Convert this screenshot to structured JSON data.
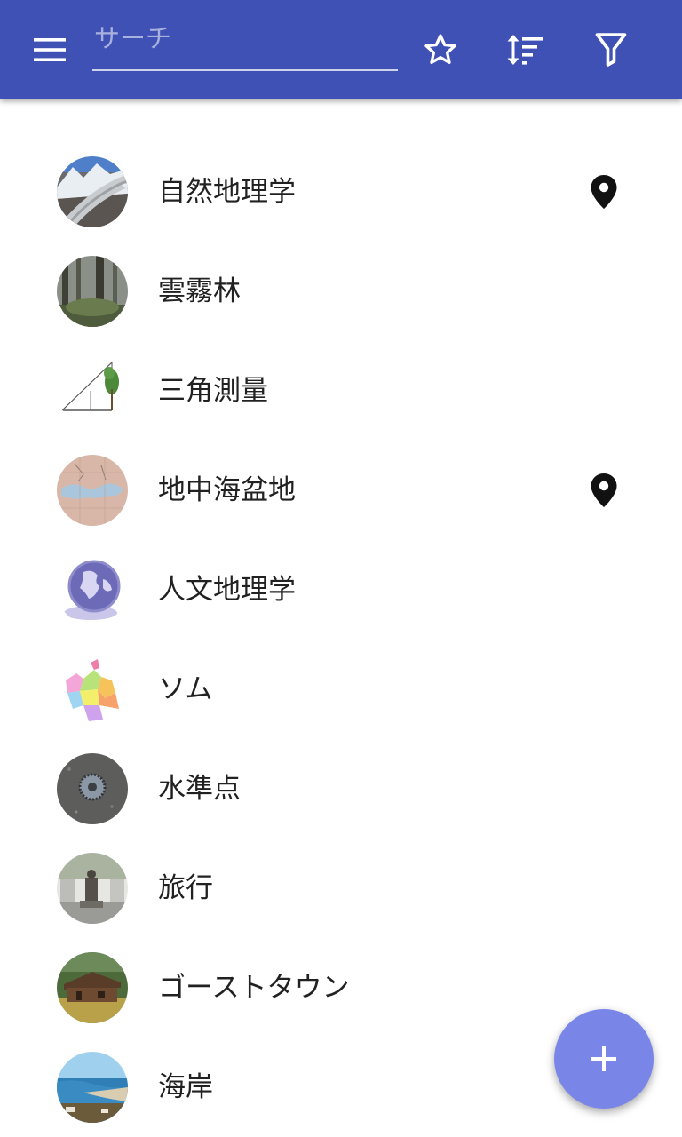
{
  "appbar": {
    "background": "#3f51b5",
    "menu_icon": "hamburger-menu-icon",
    "search": {
      "placeholder": "サーチ",
      "value": ""
    },
    "actions": [
      "star-outline-icon",
      "sort-icon",
      "filter-icon"
    ]
  },
  "list": {
    "items": [
      {
        "label": "自然地理学",
        "thumbnail": "glacier-mountain-photo",
        "has_location": true
      },
      {
        "label": "雲霧林",
        "thumbnail": "misty-forest-photo",
        "has_location": false
      },
      {
        "label": "三角測量",
        "thumbnail": "triangulation-tree-diagram",
        "has_location": false
      },
      {
        "label": "地中海盆地",
        "thumbnail": "mediterranean-map",
        "has_location": true
      },
      {
        "label": "人文地理学",
        "thumbnail": "globe-icon-image",
        "has_location": false
      },
      {
        "label": "ソム",
        "thumbnail": "colored-region-map",
        "has_location": false
      },
      {
        "label": "水準点",
        "thumbnail": "benchmark-marker-photo",
        "has_location": false
      },
      {
        "label": "旅行",
        "thumbnail": "statue-street-photo",
        "has_location": false
      },
      {
        "label": "ゴーストタウン",
        "thumbnail": "wooden-cabin-photo",
        "has_location": false
      },
      {
        "label": "海岸",
        "thumbnail": "coastline-photo",
        "has_location": false
      }
    ]
  },
  "fab": {
    "icon": "plus-icon",
    "color": "#7986e8"
  }
}
